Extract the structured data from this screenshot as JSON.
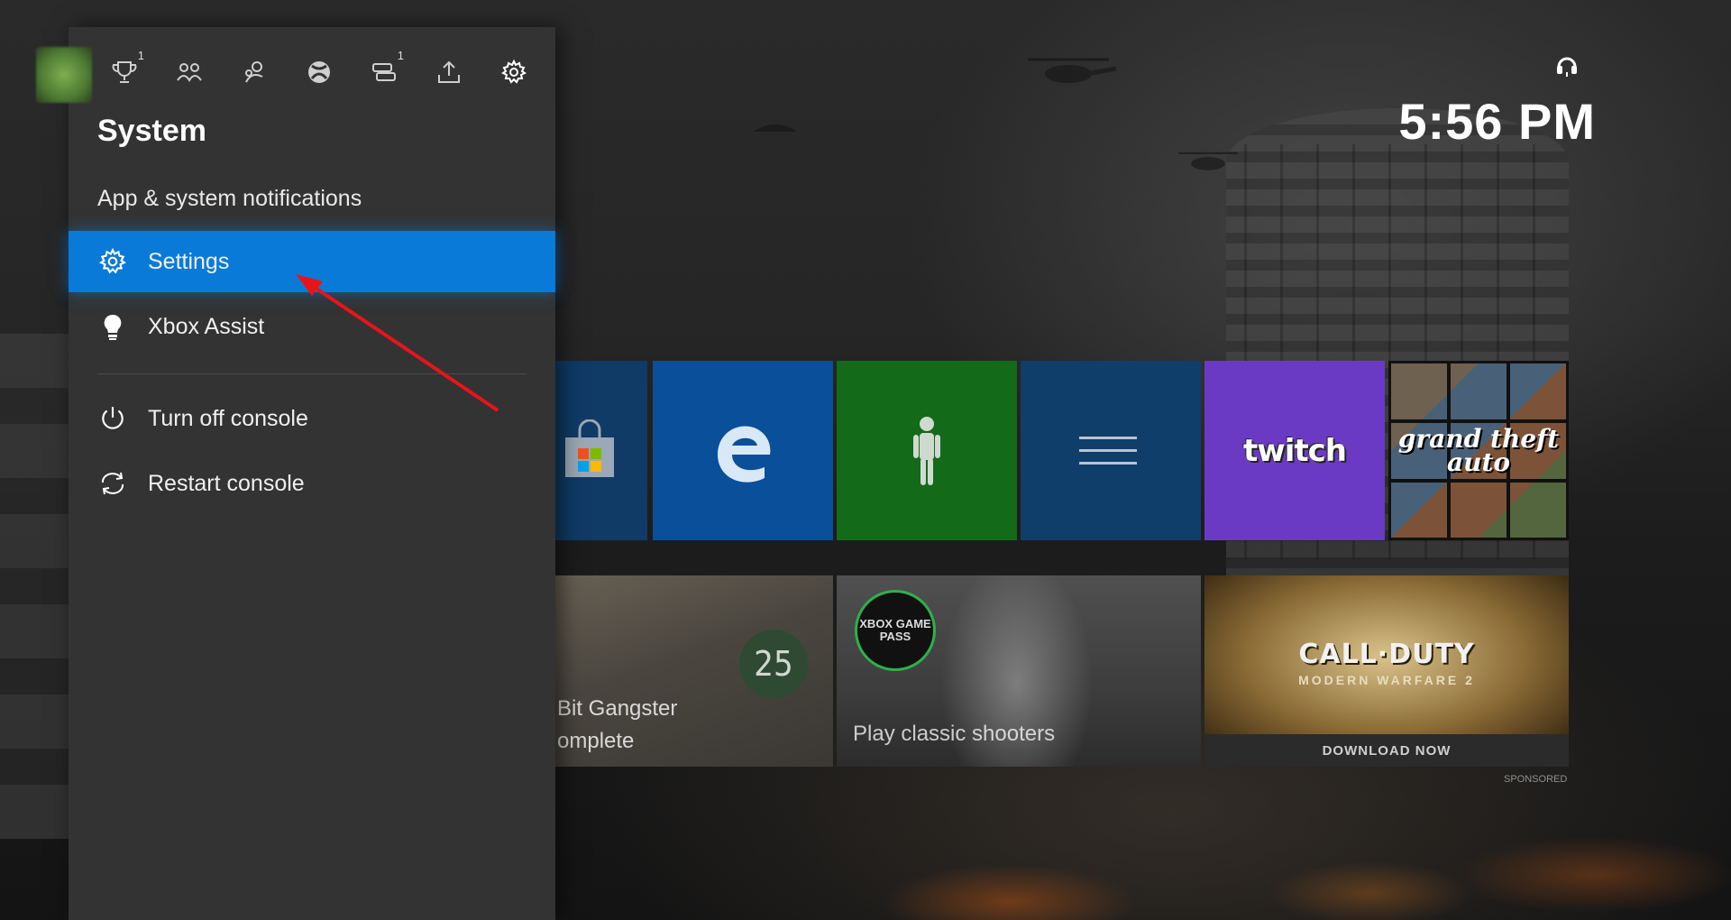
{
  "clock": {
    "time": "5:56 PM"
  },
  "guide": {
    "tabs": [
      {
        "name": "achievements",
        "badge": "1"
      },
      {
        "name": "party"
      },
      {
        "name": "people"
      },
      {
        "name": "xbox-home"
      },
      {
        "name": "messages",
        "badge": "1"
      },
      {
        "name": "broadcast"
      },
      {
        "name": "system"
      }
    ],
    "title": "System",
    "notifications_label": "App & system notifications",
    "items": [
      {
        "label": "Settings",
        "icon": "gear-icon",
        "active": true
      },
      {
        "label": "Xbox Assist",
        "icon": "lightbulb-icon"
      },
      {
        "label": "Turn off console",
        "icon": "power-icon"
      },
      {
        "label": "Restart console",
        "icon": "restart-icon"
      }
    ]
  },
  "home": {
    "tiles": [
      {
        "name": "microsoft-store"
      },
      {
        "name": "microsoft-edge"
      },
      {
        "name": "avatar-app"
      },
      {
        "name": "guide-app"
      },
      {
        "name": "twitch",
        "label": "twitch"
      },
      {
        "name": "gta-v",
        "label": "grand theft auto"
      }
    ],
    "featured": {
      "gangster": {
        "line1": "Bit Gangster",
        "line2": "omplete",
        "badge": "25"
      },
      "gamepass": {
        "logo_text": "XBOX GAME PASS",
        "caption": "Play classic shooters"
      },
      "cod": {
        "title": "CALL·DUTY",
        "subtitle": "MODERN WARFARE 2",
        "cta": "DOWNLOAD NOW",
        "sponsored": "SPONSORED"
      }
    }
  },
  "colors": {
    "accent": "#0a7ad8",
    "panel": "#333333",
    "twitch": "#6b3ac4",
    "edge": "#0a4f9a",
    "avatar_tile": "#136a19"
  }
}
